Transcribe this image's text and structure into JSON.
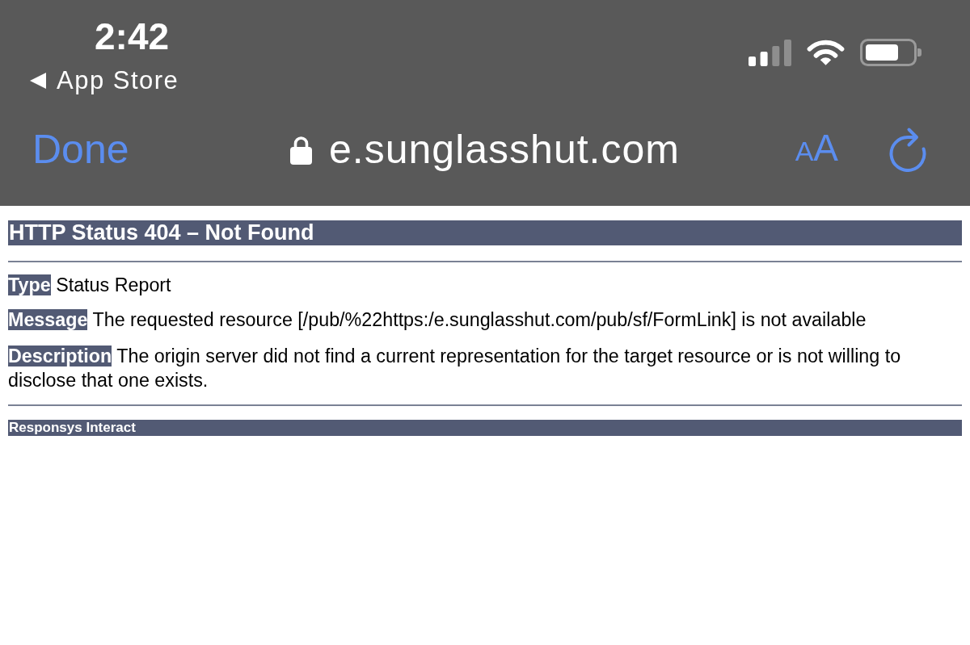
{
  "status_bar": {
    "time": "2:42",
    "back_link": "App Store"
  },
  "toolbar": {
    "done_button": "Done",
    "secure": true,
    "address": "e.sunglasshut.com",
    "text_size_button": {
      "small": "A",
      "large": "A"
    }
  },
  "page": {
    "heading": "HTTP Status 404 – Not Found",
    "fields": [
      {
        "label": "Type",
        "value": "Status Report"
      },
      {
        "label": "Message",
        "value": "The requested resource [/pub/%22https:/e.sunglasshut.com/pub/sf/FormLink] is not available"
      },
      {
        "label": "Description",
        "value": "The origin server did not find a current representation for the target resource or is not willing to disclose that one exists."
      }
    ],
    "footer": "Responsys Interact"
  }
}
